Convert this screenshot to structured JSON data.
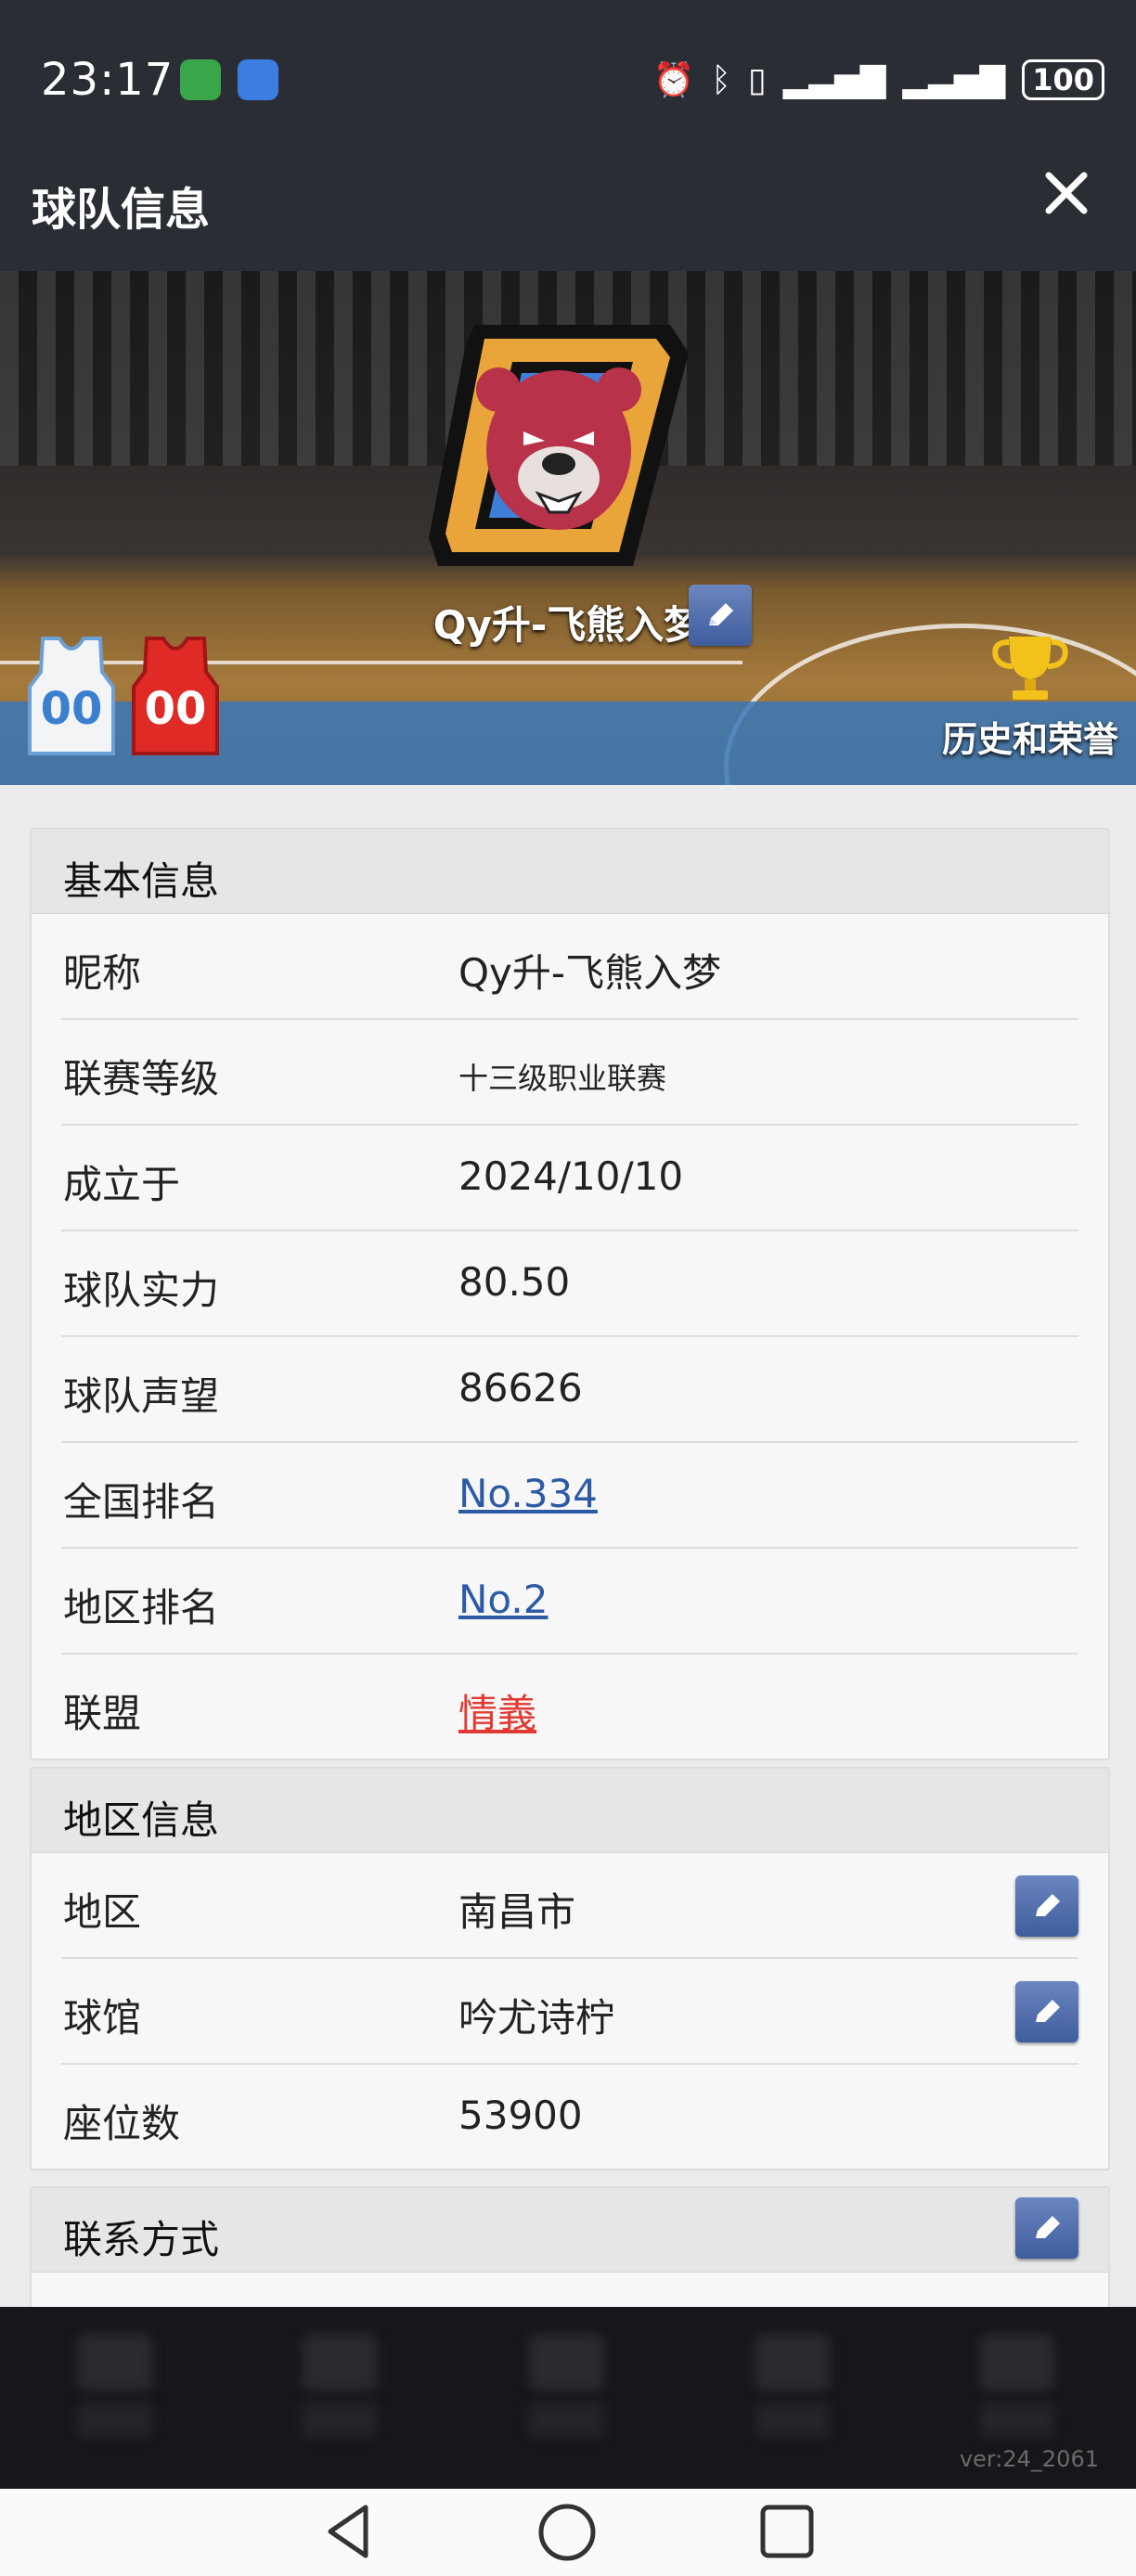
{
  "status_bar": {
    "time": "23:17",
    "battery": "100"
  },
  "header": {
    "title": "球队信息"
  },
  "banner": {
    "team_name": "Qy升-飞熊入梦",
    "home_jersey_number": "00",
    "away_jersey_number": "00",
    "honors_label": "历史和荣誉"
  },
  "basic_info": {
    "title": "基本信息",
    "rows": [
      {
        "label": "昵称",
        "value": "Qy升-飞熊入梦"
      },
      {
        "label": "联赛等级",
        "value": "十三级职业联赛"
      },
      {
        "label": "成立于",
        "value": "2024/10/10"
      },
      {
        "label": "球队实力",
        "value": "80.50"
      },
      {
        "label": "球队声望",
        "value": "86626"
      },
      {
        "label": "全国排名",
        "value": "No.334"
      },
      {
        "label": "地区排名",
        "value": "No.2"
      },
      {
        "label": "联盟",
        "value": "情義"
      }
    ]
  },
  "region_info": {
    "title": "地区信息",
    "rows": [
      {
        "label": "地区",
        "value": "南昌市"
      },
      {
        "label": "球馆",
        "value": "吟尤诗柠"
      },
      {
        "label": "座位数",
        "value": "53900"
      }
    ]
  },
  "contact": {
    "title": "联系方式"
  },
  "footer": {
    "version": "ver:24_2061"
  },
  "colors": {
    "link": "#2c5aa5",
    "alliance": "#e23a32",
    "edit_button": "#4a68a8",
    "header_bg": "#2a2d33"
  }
}
